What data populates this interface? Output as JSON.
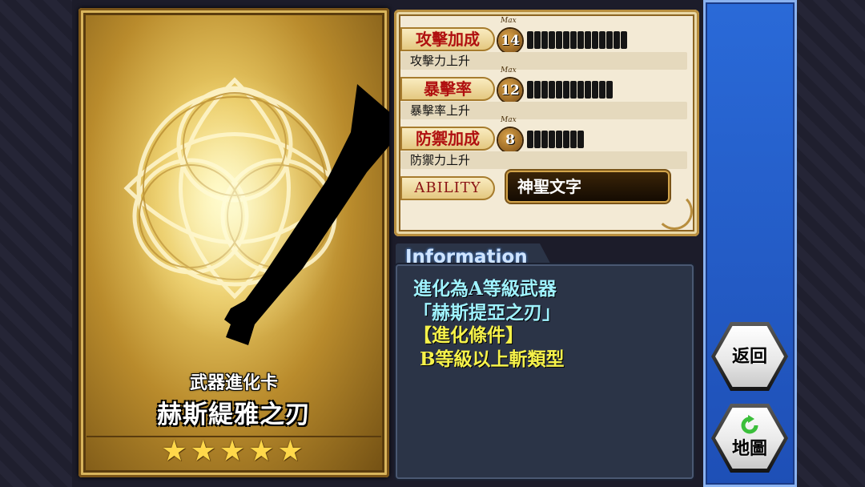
{
  "card": {
    "type": "武器進化卡",
    "name": "赫斯緹雅之刃",
    "stars": "★★★★★",
    "rarity_stars": 5
  },
  "stats": [
    {
      "label": "攻擊加成",
      "max_label": "Max",
      "level": "14",
      "bar_count": 14,
      "desc": "攻擊力上升"
    },
    {
      "label": "暴擊率",
      "max_label": "Max",
      "level": "12",
      "bar_count": 12,
      "desc": "暴擊率上升"
    },
    {
      "label": "防禦加成",
      "max_label": "Max",
      "level": "8",
      "bar_count": 8,
      "desc": "防禦力上升"
    }
  ],
  "ability": {
    "label": "ABILITY",
    "value": "神聖文字"
  },
  "info": {
    "title": "Information",
    "lines": [
      "進化為A等級武器",
      "「赫斯提亞之刃」",
      "【進化條件】",
      " B等級以上斬類型"
    ]
  },
  "buttons": {
    "back": "返回",
    "map": "地圖"
  },
  "colors": {
    "stat_label_text": "#b01010",
    "info_cyan": "#9ff2ff",
    "info_yellow": "#f6f24a",
    "right_panel": "#2a6ad8",
    "map_icon": "#3bbf3b"
  },
  "icons": {
    "map": "refresh-icon"
  }
}
